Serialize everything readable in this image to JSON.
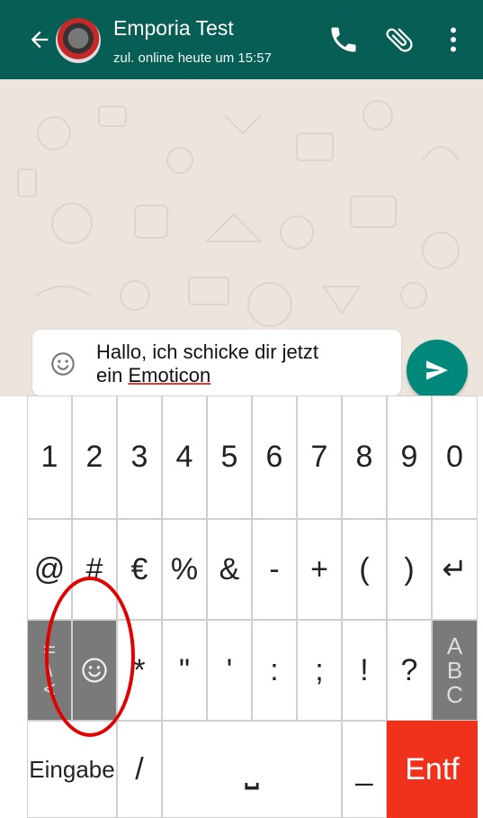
{
  "header": {
    "title": "Emporia Test",
    "subtitle": "zul. online heute um 15:57",
    "back_icon": "arrow-left-icon",
    "call_icon": "phone-icon",
    "attach_icon": "paperclip-icon",
    "menu_icon": "more-vertical-icon"
  },
  "composer": {
    "text_line1": "Hallo, ich schicke dir jetzt",
    "text_line2_prefix": "ein ",
    "text_line2_word": "Emoticon",
    "emoji_icon": "smiley-icon",
    "send_icon": "send-icon"
  },
  "keyboard": {
    "row1": [
      "1",
      "2",
      "3",
      "4",
      "5",
      "6",
      "7",
      "8",
      "9",
      "0"
    ],
    "row2": [
      "@",
      "#",
      "€",
      "%",
      "&",
      "-",
      "+",
      "(",
      ")",
      "↵"
    ],
    "row3_left_top": "=",
    "row3_left_mid": "\\",
    "row3_left_bot": "<",
    "row3_emoji": "☺",
    "row3": [
      "*",
      "\"",
      "'",
      ":",
      ";",
      "!",
      "?"
    ],
    "row3_abc": [
      "A",
      "B",
      "C"
    ],
    "row4_enter": "Eingabe",
    "row4_slash": "/",
    "row4_space": "⎵",
    "row4_underscore": "_",
    "row4_delete": "Entf"
  },
  "colors": {
    "header": "#075e54",
    "send": "#00897b",
    "delete_key": "#f0321c",
    "highlight_circle": "#e00000"
  }
}
